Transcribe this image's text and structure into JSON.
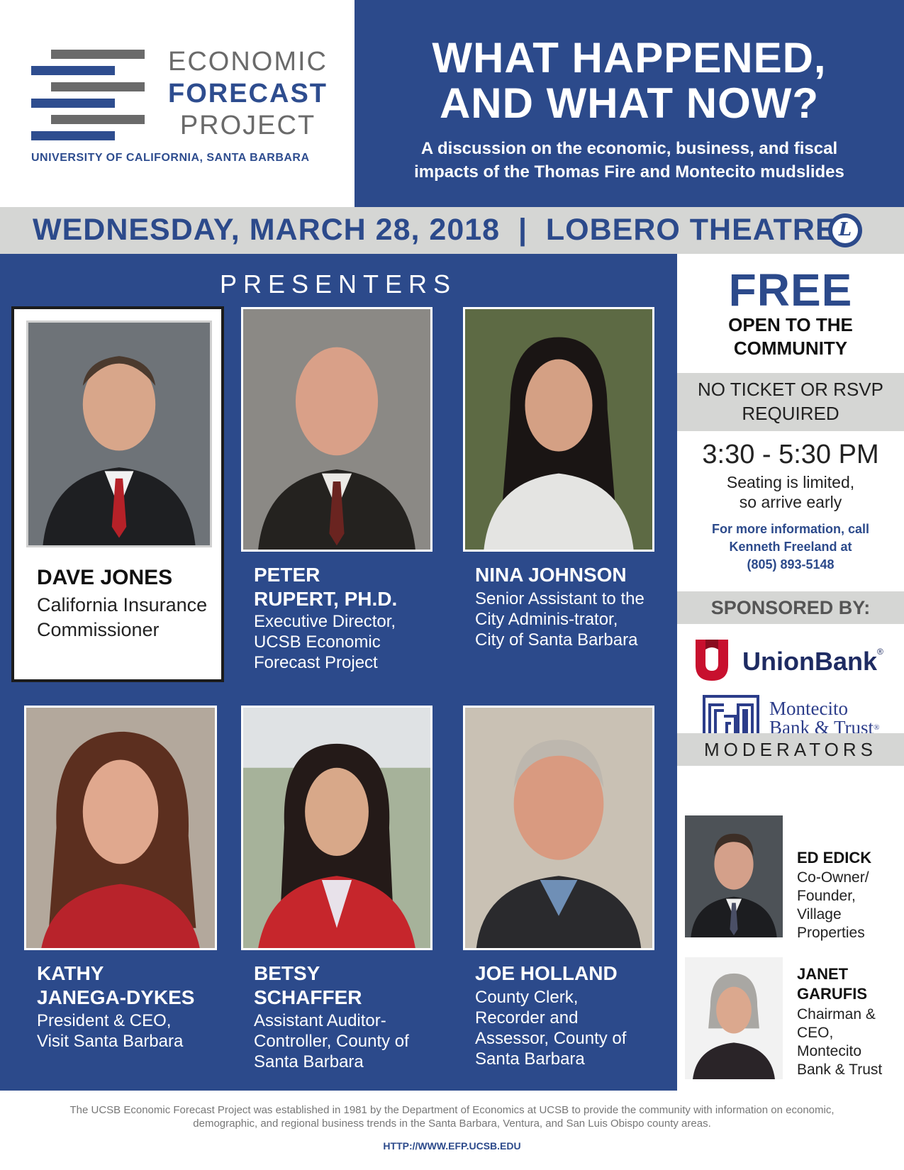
{
  "logo": {
    "line1": "ECONOMIC",
    "line2": "FORECAST",
    "line3": "PROJECT",
    "university": "UNIVERSITY OF CALIFORNIA, SANTA BARBARA"
  },
  "headline": {
    "line1": "WHAT HAPPENED,",
    "line2": "AND WHAT NOW?",
    "subtitle_line1": "A discussion on the economic, business, and fiscal",
    "subtitle_line2": "impacts of the Thomas Fire and Montecito mudslides"
  },
  "event": {
    "date_venue": "WEDNESDAY, MARCH 28, 2018  |  LOBERO THEATRE",
    "venue_icon_letter": "L"
  },
  "presenters": {
    "title": "PRESENTERS",
    "people": [
      {
        "name": "DAVE JONES",
        "title": "California Insurance Commissioner"
      },
      {
        "name_line1": "PETER",
        "name_line2": "RUPERT, PH.D.",
        "title": "Executive Director, UCSB Economic Forecast Project"
      },
      {
        "name": "NINA JOHNSON",
        "title": "Senior Assistant to the City Adminis-trator, City of Santa Barbara"
      },
      {
        "name_line1": "KATHY",
        "name_line2": "JANEGA-DYKES",
        "title": "President & CEO, Visit Santa Barbara"
      },
      {
        "name_line1": "BETSY",
        "name_line2": "SCHAFFER",
        "title": "Assistant Auditor-Controller, County of Santa Barbara"
      },
      {
        "name": "JOE HOLLAND",
        "title": "County Clerk, Recorder and Assessor, County of Santa Barbara"
      }
    ]
  },
  "sidebar": {
    "free": "FREE",
    "open_line1": "OPEN TO THE",
    "open_line2": "COMMUNITY",
    "no_ticket_line1": "NO TICKET OR RSVP",
    "no_ticket_line2": "REQUIRED",
    "time": "3:30 - 5:30 PM",
    "seating_line1": "Seating is limited,",
    "seating_line2": "so arrive early",
    "info_line1": "For more information, call",
    "info_line2": "Kenneth Freeland at",
    "info_line3": "(805) 893-5148",
    "sponsored_by": "SPONSORED BY:",
    "sponsor1": "UnionBank",
    "sponsor1_mark": "®",
    "sponsor2_line1": "Montecito",
    "sponsor2_line2": "Bank & Trust",
    "sponsor2_mark": "®",
    "moderators_title": "MODERATORS",
    "moderators": [
      {
        "name": "ED EDICK",
        "title": "Co-Owner/ Founder, Village Properties"
      },
      {
        "name_line1": "JANET",
        "name_line2": "GARUFIS",
        "title": "Chairman & CEO, Montecito Bank & Trust"
      }
    ]
  },
  "footer": {
    "text": "The UCSB Economic Forecast Project was established in 1981 by the Department of Economics at UCSB to provide the community with information on economic, demographic, and regional business trends in the Santa Barbara, Ventura, and San Luis Obispo county areas.",
    "url": "HTTP://WWW.EFP.UCSB.EDU"
  },
  "colors": {
    "brand_blue": "#2c4a8b",
    "bar_gray": "#d5d6d4",
    "logo_gray": "#6a6a6a",
    "unionbank_red": "#c8102e"
  }
}
